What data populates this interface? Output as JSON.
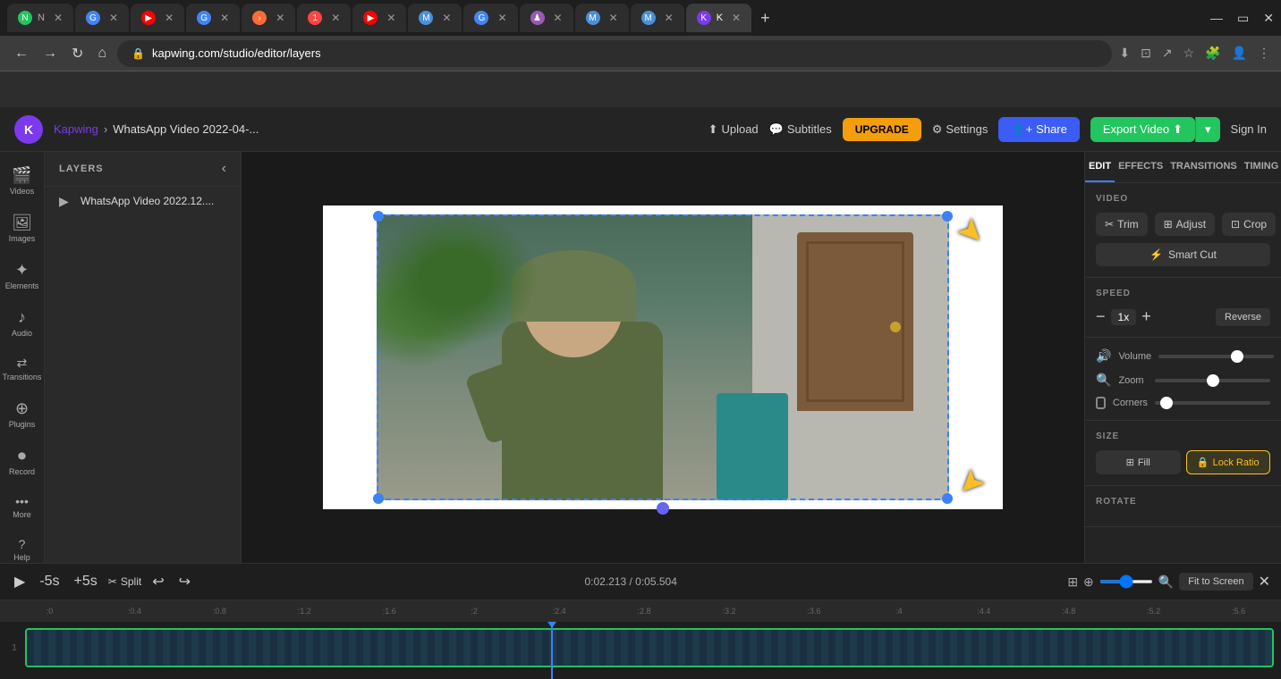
{
  "browser": {
    "tabs": [
      {
        "label": "N",
        "favicon_bg": "#22c55e",
        "active": false
      },
      {
        "label": "G",
        "favicon_bg": "#4285f4",
        "active": false
      },
      {
        "label": "",
        "favicon_bg": "#ff0000",
        "active": false
      },
      {
        "label": "G",
        "favicon_bg": "#4285f4",
        "active": false
      },
      {
        "label": ">",
        "favicon_bg": "#ff6b35",
        "active": false
      },
      {
        "label": "1",
        "favicon_bg": "#ff4444",
        "active": false
      },
      {
        "label": "",
        "favicon_bg": "#ff0000",
        "active": false
      },
      {
        "label": "M",
        "favicon_bg": "#4a90d9",
        "active": false
      },
      {
        "label": "G",
        "favicon_bg": "#4285f4",
        "active": false
      },
      {
        "label": "",
        "favicon_bg": "#9b59b6",
        "active": false
      },
      {
        "label": "M",
        "favicon_bg": "#4a90d9",
        "active": false
      },
      {
        "label": "M",
        "favicon_bg": "#4a90d9",
        "active": false
      },
      {
        "label": "K",
        "favicon_bg": "#7c3aed",
        "active": true
      }
    ],
    "url": "kapwing.com/studio/editor/layers",
    "new_tab_label": "+"
  },
  "app": {
    "header": {
      "logo_letter": "K",
      "brand": "Kapwing",
      "breadcrumb_sep": "›",
      "project_name": "WhatsApp Video 2022-04-...",
      "upload_label": "Upload",
      "subtitles_label": "Subtitles",
      "upgrade_label": "UPGRADE",
      "settings_label": "Settings",
      "share_label": "Share",
      "export_label": "Export Video",
      "signin_label": "Sign In"
    },
    "sidebar": {
      "items": [
        {
          "icon": "🎬",
          "label": "Videos"
        },
        {
          "icon": "🖼",
          "label": "Images"
        },
        {
          "icon": "✦",
          "label": "Elements"
        },
        {
          "icon": "♪",
          "label": "Audio"
        },
        {
          "icon": "⇄",
          "label": "Transitions"
        },
        {
          "icon": "🔌",
          "label": "Plugins"
        },
        {
          "icon": "⏺",
          "label": "Record"
        },
        {
          "icon": "•••",
          "label": "More"
        },
        {
          "icon": "?",
          "label": "Help"
        }
      ]
    },
    "layers": {
      "title": "LAYERS",
      "items": [
        {
          "icon": "▶",
          "name": "WhatsApp Video 2022.12...."
        }
      ]
    },
    "right_panel": {
      "tabs": [
        "EDIT",
        "EFFECTS",
        "TRANSITIONS",
        "TIMING"
      ],
      "active_tab": "EDIT",
      "sections": {
        "video_label": "VIDEO",
        "trim_label": "Trim",
        "adjust_label": "Adjust",
        "crop_label": "Crop",
        "smart_cut_label": "Smart Cut",
        "speed_label": "SPEED",
        "speed_minus": "−",
        "speed_value": "1x",
        "speed_plus": "+",
        "reverse_label": "Reverse",
        "volume_label": "Volume",
        "zoom_label": "Zoom",
        "corners_label": "Corners",
        "size_label": "SIZE",
        "fill_label": "Fill",
        "lock_ratio_label": "Lock Ratio",
        "rotate_label": "ROTATE"
      }
    },
    "timeline": {
      "play_icon": "▶",
      "minus5_label": "-5s",
      "plus5_label": "+5s",
      "split_label": "Split",
      "undo_label": "↩",
      "redo_label": "↪",
      "time_current": "0:02.213",
      "time_total": "0:05.504",
      "fit_to_screen_label": "Fit to Screen",
      "ruler_marks": [
        ":0",
        ":0.4",
        ":0.8",
        ":1.2",
        ":1.6",
        ":2",
        ":2.4",
        ":2.8",
        ":3.2",
        ":3.6",
        ":4",
        ":4.4",
        ":4.8",
        ":5.2",
        ":5.6"
      ],
      "track_num": "1"
    }
  }
}
